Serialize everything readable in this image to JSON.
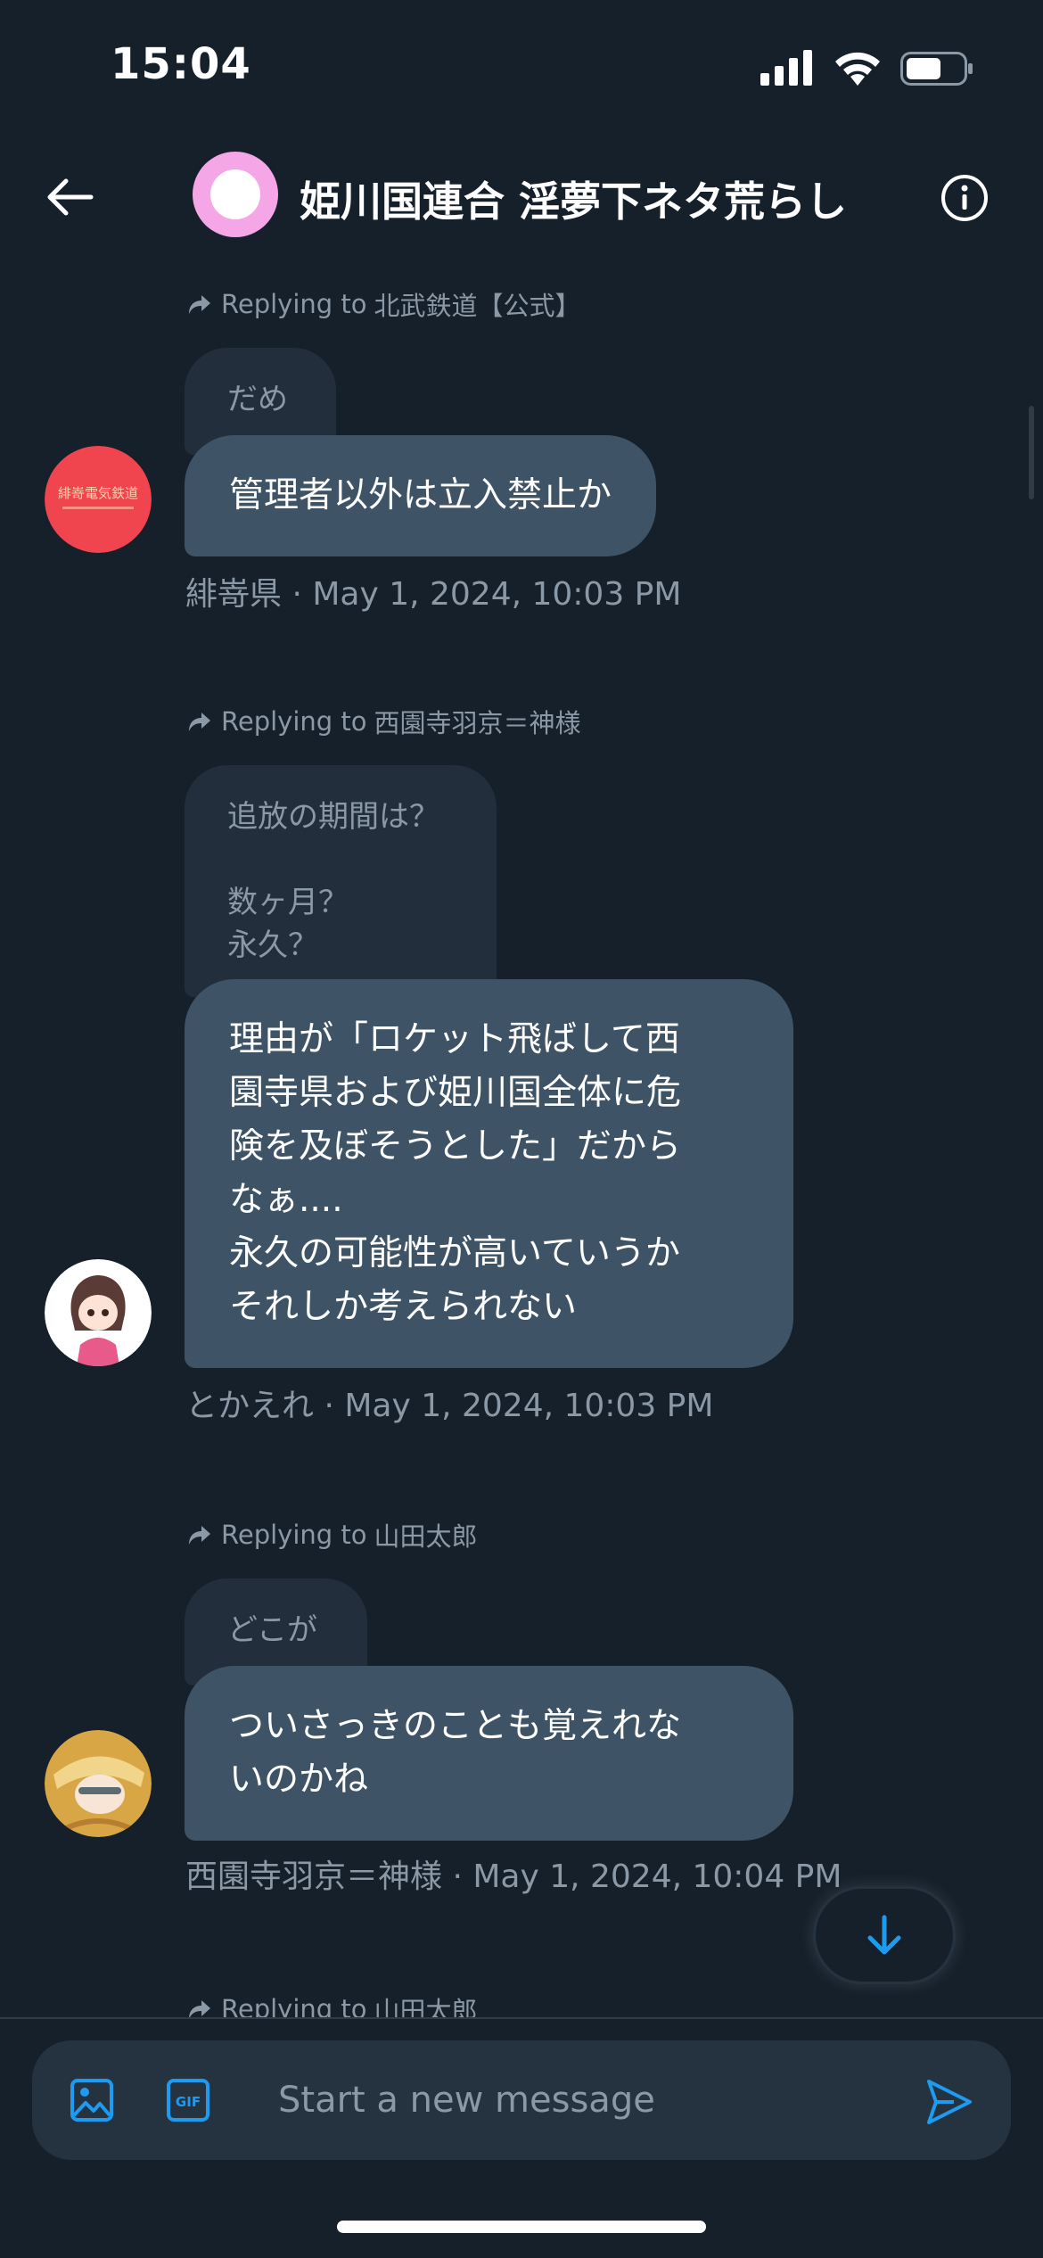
{
  "status_bar": {
    "time": "15:04"
  },
  "header": {
    "title": "姫川国連合 淫夢下ネタ荒らし"
  },
  "messages": [
    {
      "reply_prefix": "Replying to",
      "reply_to": "北武鉄道【公式】",
      "quoted_text": "だめ",
      "text": "管理者以外は立入禁止か",
      "sender": "緋嵜県",
      "timestamp": "May 1, 2024, 10:03 PM",
      "meta": "緋嵜県 · May 1, 2024, 10:03 PM",
      "avatar_text": "緋嵜電気鉄道"
    },
    {
      "reply_prefix": "Replying to",
      "reply_to": "西園寺羽京＝神様",
      "quoted_text": "追放の期間は？\n\n数ヶ月？\n永久？",
      "text": "理由が「ロケット飛ばして西\n園寺県および姫川国全体に危\n険を及ぼそうとした」だから\nなぁ....\n永久の可能性が高いていうか\nそれしか考えられない",
      "sender": "とかえれ",
      "timestamp": "May 1, 2024, 10:03 PM",
      "meta": "とかえれ · May 1, 2024, 10:03 PM"
    },
    {
      "reply_prefix": "Replying to",
      "reply_to": "山田太郎",
      "quoted_text": "どこが",
      "text": "ついさっきのことも覚えれな\nいのかね",
      "sender": "西園寺羽京＝神様",
      "timestamp": "May 1, 2024, 10:04 PM",
      "meta": "西園寺羽京＝神様 · May 1, 2024, 10:04 PM"
    },
    {
      "reply_prefix": "Replying to",
      "reply_to": "山田太郎"
    }
  ],
  "composer": {
    "placeholder": "Start a new message"
  },
  "colors": {
    "background": "#15202b",
    "bubble": "#3e5466",
    "quoted_bubble": "#222e3b",
    "accent": "#1d9bf0",
    "muted_text": "#8b98a5"
  }
}
